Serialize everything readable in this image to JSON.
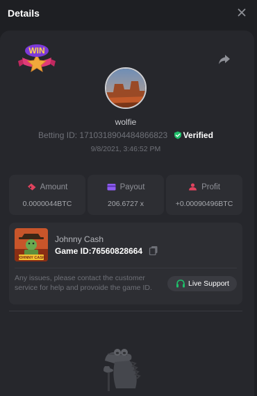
{
  "modal": {
    "title": "Details",
    "icons": {
      "close": "close-icon",
      "share": "share-icon"
    }
  },
  "badge": {
    "text": "WIN",
    "icon": "win-badge-icon"
  },
  "player": {
    "username": "wolfie",
    "betting_id_label": "Betting ID:",
    "betting_id": "1710318904484866823",
    "verified_label": "Verified",
    "datetime": "9/8/2021, 3:46:52 PM"
  },
  "stats": [
    {
      "label": "Amount",
      "value": "0.0000044BTC",
      "icon": "ticket-icon",
      "color": "#e0435e"
    },
    {
      "label": "Payout",
      "value": "206.6727 x",
      "icon": "wallet-icon",
      "color": "#8e5cf0"
    },
    {
      "label": "Profit",
      "value": "+0.00090496BTC",
      "icon": "profit-icon",
      "color": "#e0435e"
    }
  ],
  "game": {
    "name": "Johnny Cash",
    "thumb_label": "JOHNNY CASH",
    "id_label": "Game ID:",
    "id": "76560828664",
    "help_text": "Any issues, please contact the customer service for help and provoide the game ID.",
    "support_label": "Live Support"
  },
  "colors": {
    "background": "#1e1f23",
    "card": "#26272c",
    "panel": "#2d2e33",
    "verified": "#1fbf6a",
    "support_icon": "#1fbf6a"
  }
}
